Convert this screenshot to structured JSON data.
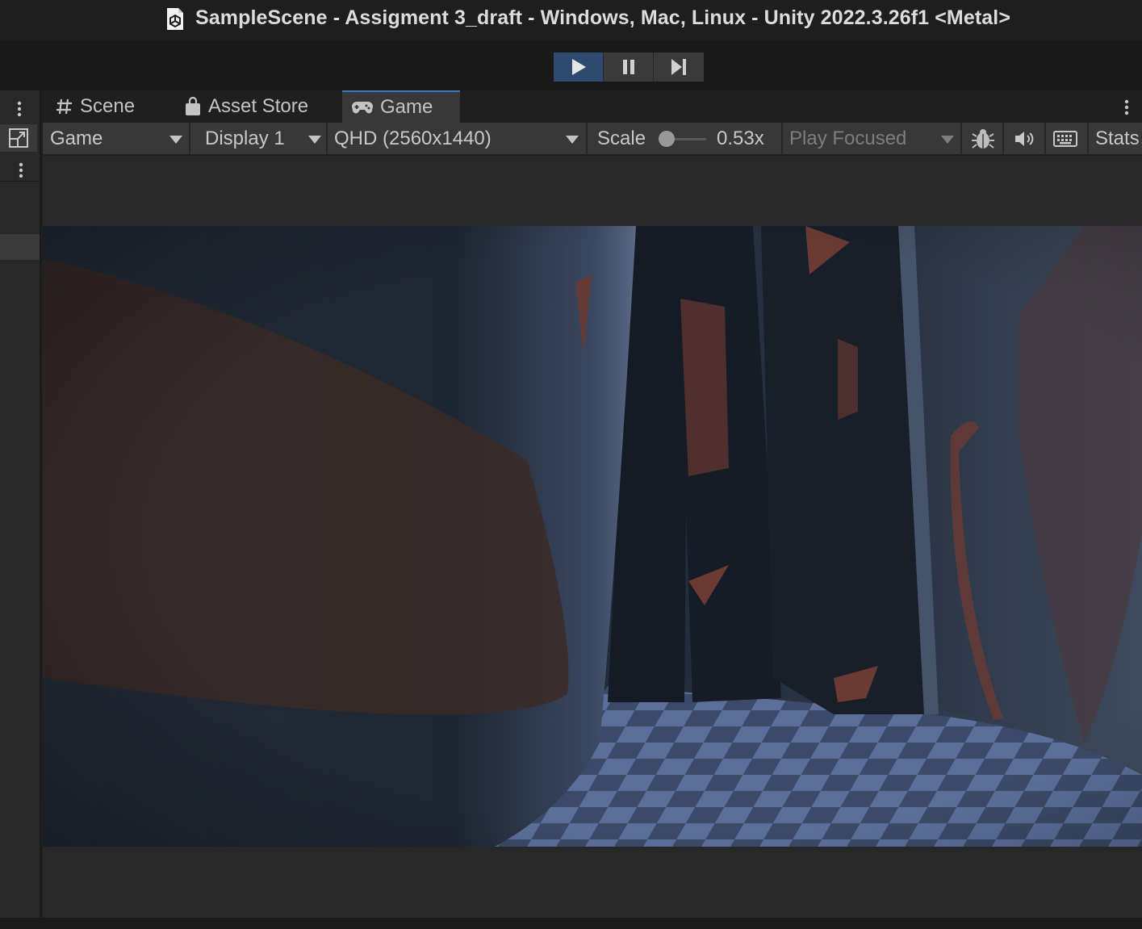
{
  "window": {
    "title": "SampleScene - Assigment 3_draft - Windows, Mac, Linux - Unity 2022.3.26f1 <Metal>",
    "logo_icon": "unity-logo-icon"
  },
  "playbar": {
    "buttons": [
      {
        "icon": "play-icon",
        "state": "active"
      },
      {
        "icon": "pause-icon",
        "state": "inactive"
      },
      {
        "icon": "step-icon",
        "state": "inactive"
      }
    ],
    "active_color": "#2e4a6e"
  },
  "tabs": [
    {
      "label": "Scene",
      "icon": "hash-icon",
      "active": false
    },
    {
      "label": "Asset Store",
      "icon": "shopping-bag-icon",
      "active": false
    },
    {
      "label": "Game",
      "icon": "gamepad-icon",
      "active": true
    }
  ],
  "game_toolbar": {
    "view_select": "Game",
    "display_select": "Display 1",
    "resolution_select": "QHD (2560x1440)",
    "scale_label": "Scale",
    "scale_value": "0.53x",
    "play_mode_select": "Play Focused",
    "icons": [
      "bug-icon",
      "speaker-icon",
      "keyboard-icon"
    ],
    "stats_label": "Stats"
  },
  "colors": {
    "accent": "#3a79bb",
    "panel": "#383838",
    "background": "#1e1e1e"
  }
}
